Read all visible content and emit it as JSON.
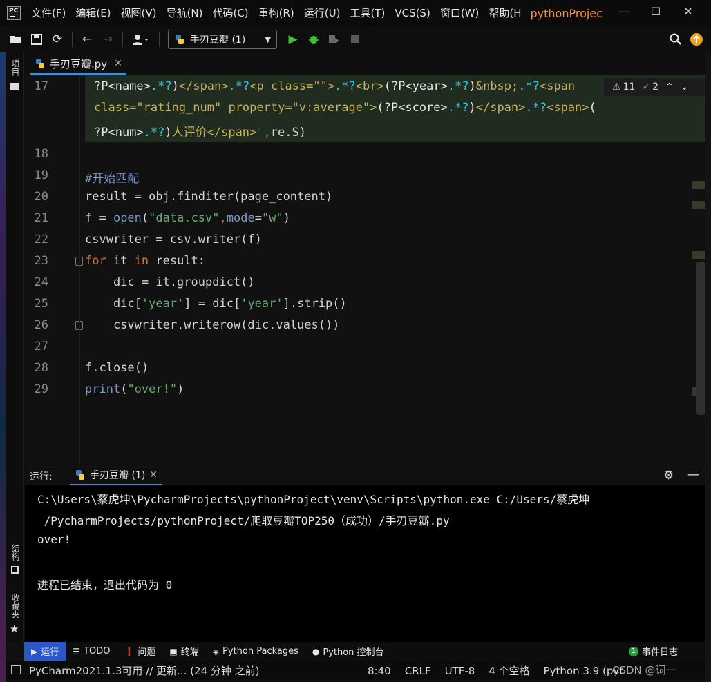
{
  "menubar": {
    "items": [
      "文件(F)",
      "编辑(E)",
      "视图(V)",
      "导航(N)",
      "代码(C)",
      "重构(R)",
      "运行(U)",
      "工具(T)",
      "VCS(S)",
      "窗口(W)",
      "帮助(H"
    ],
    "project_title": "pythonProjec",
    "logo_text": "PC"
  },
  "toolbar": {
    "run_config": "手刃豆瓣 (1)"
  },
  "left_tabs": {
    "project": "项目",
    "structure": "结构",
    "favorites": "收藏夹"
  },
  "editor": {
    "file_tab": "手刃豆瓣.py",
    "line_numbers": [
      "17",
      "18",
      "19",
      "20",
      "21",
      "22",
      "23",
      "24",
      "25",
      "26",
      "27",
      "28",
      "29"
    ],
    "inspection": {
      "warnings": "11",
      "weak_warnings": "2"
    }
  },
  "run_panel": {
    "label": "运行:",
    "tab": "手刃豆瓣 (1)",
    "output": [
      "C:\\Users\\蔡虎坤\\PycharmProjects\\pythonProject\\venv\\Scripts\\python.exe C:/Users/蔡虎坤",
      " /PycharmProjects/pythonProject/爬取豆瓣TOP250（成功）/手刃豆瓣.py",
      "over!",
      "",
      "进程已结束，退出代码为 0"
    ]
  },
  "bottom_tabs": {
    "run": "运行",
    "todo": "TODO",
    "problems": "问题",
    "terminal": "终端",
    "packages": "Python Packages",
    "console": "Python 控制台",
    "event_log": "事件日志",
    "event_count": "1"
  },
  "statusbar": {
    "message": "PyCharm2021.1.3可用 // 更新... (24 分钟 之前)",
    "position": "8:40",
    "line_sep": "CRLF",
    "encoding": "UTF-8",
    "indent": "4 个空格",
    "interpreter": "Python 3.9 (pyt"
  },
  "watermark": "CSDN @词一"
}
